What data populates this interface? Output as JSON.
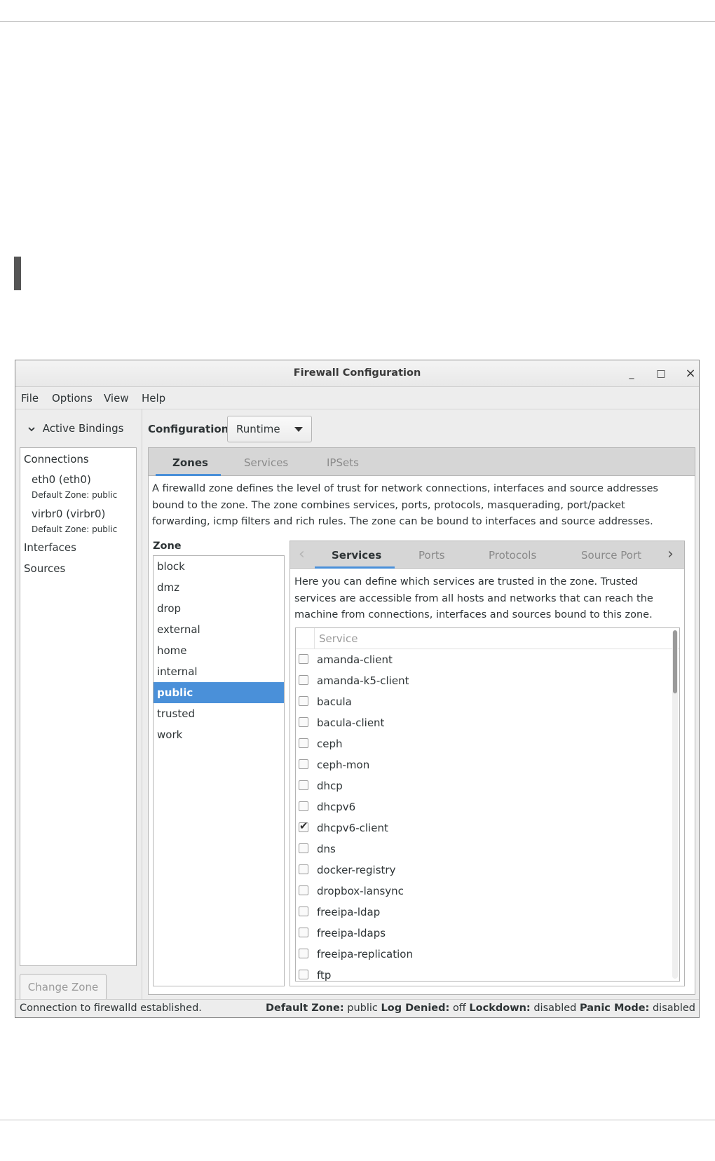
{
  "window": {
    "title": "Firewall Configuration",
    "minimize_glyph": "_",
    "maximize_glyph": "□",
    "close_glyph": "×"
  },
  "menubar": {
    "items": [
      "File",
      "Options",
      "View",
      "Help"
    ]
  },
  "bindings": {
    "toggle_label": "Active Bindings",
    "connections_label": "Connections",
    "connections": [
      {
        "name": "eth0 (eth0)",
        "zone": "Default Zone: public"
      },
      {
        "name": "virbr0 (virbr0)",
        "zone": "Default Zone: public"
      }
    ],
    "interfaces_label": "Interfaces",
    "sources_label": "Sources",
    "change_zone_label": "Change Zone"
  },
  "configuration": {
    "label": "Configuration:",
    "value": "Runtime"
  },
  "main_tabs": {
    "items": [
      "Zones",
      "Services",
      "IPSets"
    ],
    "active": "Zones"
  },
  "zones": {
    "description": "A firewalld zone defines the level of trust for network connections, interfaces and source addresses bound to the zone. The zone combines services, ports, protocols, masquerading, port/packet forwarding, icmp filters and rich rules. The zone can be bound to interfaces and source addresses.",
    "list_label": "Zone",
    "items": [
      "block",
      "dmz",
      "drop",
      "external",
      "home",
      "internal",
      "public",
      "trusted",
      "work"
    ],
    "selected": "public"
  },
  "zone_tabs": {
    "items": [
      "Services",
      "Ports",
      "Protocols",
      "Source Port"
    ],
    "active": "Services"
  },
  "services": {
    "description": "Here you can define which services are trusted in the zone. Trusted services are accessible from all hosts and networks that can reach the machine from connections, interfaces and sources bound to this zone.",
    "column_header": "Service",
    "rows": [
      {
        "name": "amanda-client",
        "checked": false
      },
      {
        "name": "amanda-k5-client",
        "checked": false
      },
      {
        "name": "bacula",
        "checked": false
      },
      {
        "name": "bacula-client",
        "checked": false
      },
      {
        "name": "ceph",
        "checked": false
      },
      {
        "name": "ceph-mon",
        "checked": false
      },
      {
        "name": "dhcp",
        "checked": false
      },
      {
        "name": "dhcpv6",
        "checked": false
      },
      {
        "name": "dhcpv6-client",
        "checked": true
      },
      {
        "name": "dns",
        "checked": false
      },
      {
        "name": "docker-registry",
        "checked": false
      },
      {
        "name": "dropbox-lansync",
        "checked": false
      },
      {
        "name": "freeipa-ldap",
        "checked": false
      },
      {
        "name": "freeipa-ldaps",
        "checked": false
      },
      {
        "name": "freeipa-replication",
        "checked": false
      },
      {
        "name": "ftp",
        "checked": false
      }
    ]
  },
  "status": {
    "message": "Connection to firewalld established.",
    "default_zone_label": "Default Zone:",
    "default_zone": "public",
    "log_denied_label": "Log Denied:",
    "log_denied": "off",
    "lockdown_label": "Lockdown:",
    "lockdown": "disabled",
    "panic_label": "Panic Mode:",
    "panic": "disabled"
  },
  "colors": {
    "selection": "#4a90d9",
    "tab_underline": "#4a90d9"
  }
}
